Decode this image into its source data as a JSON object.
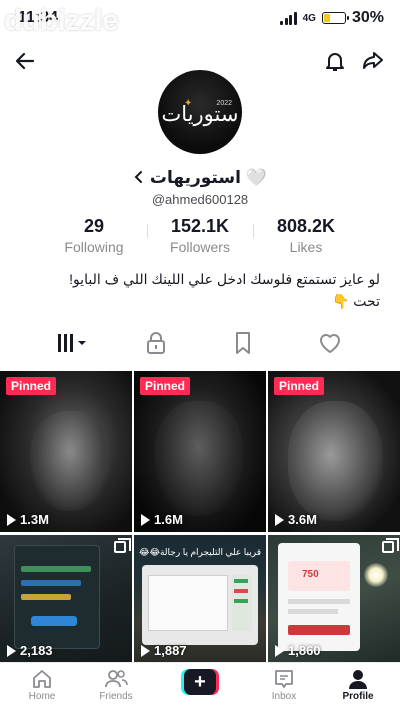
{
  "status": {
    "time": "11:34",
    "network": "4G",
    "battery": "30%",
    "battery_level": 0.3
  },
  "watermark": {
    "text": "dubizzle"
  },
  "profile": {
    "avatar_text": "ستوريات",
    "avatar_year": "2022",
    "name": "استوريهات 🤍",
    "username": "@ahmed600128",
    "bio_line1": "لو عايز تستمتع فلوسك ادخل علي اللينك اللي ف البايو!",
    "bio_line2": "تحت 👇"
  },
  "stats": [
    {
      "value": "29",
      "label": "Following"
    },
    {
      "value": "152.1K",
      "label": "Followers"
    },
    {
      "value": "808.2K",
      "label": "Likes"
    }
  ],
  "tabs": [
    "videos-grid",
    "private-lock",
    "bookmarks",
    "liked"
  ],
  "videos": [
    {
      "pinned": "Pinned",
      "views": "1.3M"
    },
    {
      "pinned": "Pinned",
      "views": "1.6M"
    },
    {
      "pinned": "Pinned",
      "views": "3.6M"
    },
    {
      "views": "2,183"
    },
    {
      "views": "1,887",
      "caption": "قريبا علي التليجرام يا رجالة😂😂"
    },
    {
      "views": "1,860"
    }
  ],
  "bottom_nav": {
    "home": "Home",
    "friends": "Friends",
    "inbox": "Inbox",
    "profile": "Profile"
  },
  "colors": {
    "accent": "#fe2c55",
    "cyan": "#25f4ee"
  }
}
